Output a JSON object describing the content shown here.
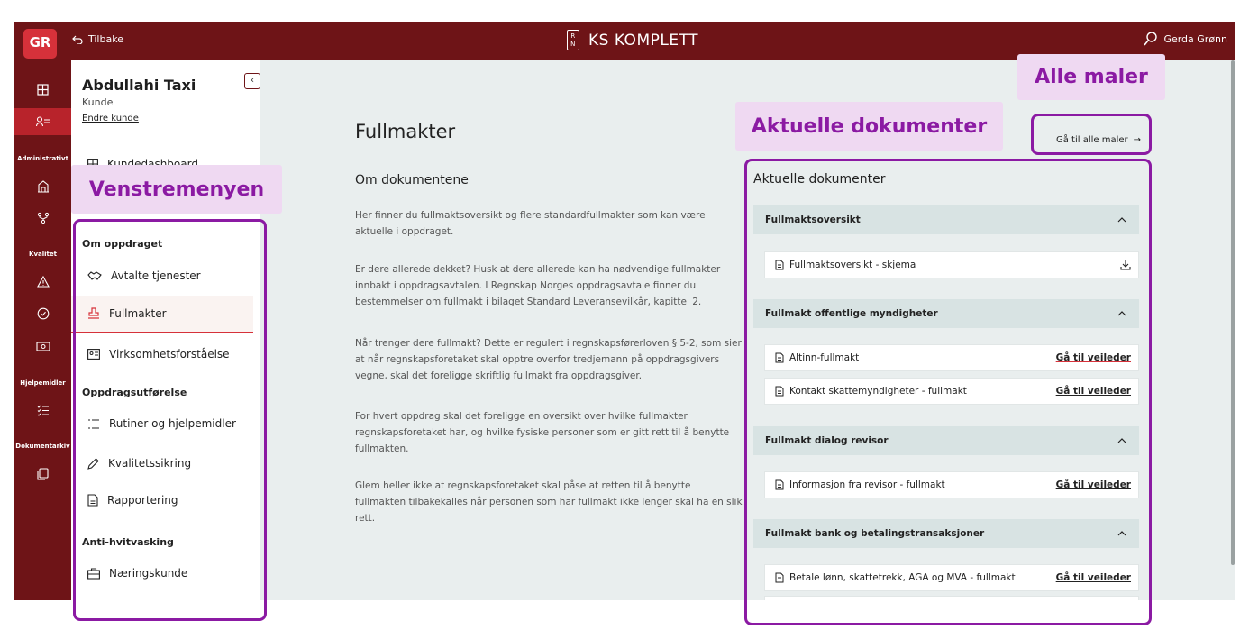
{
  "topbar": {
    "badge": "GR",
    "back_label": "Tilbake",
    "logo_letters": "R N",
    "app_title": "KS KOMPLETT",
    "user_name": "Gerda Grønn"
  },
  "rail": {
    "labels": [
      "Administrativt",
      "Kvalitet",
      "Hjelpemidler",
      "Dokumentarkiv"
    ],
    "icons": [
      "grid-icon",
      "people-list-icon",
      "building-icon",
      "network-icon",
      "warning-icon",
      "check-circle-icon",
      "money-icon",
      "checklist-icon",
      "documents-icon"
    ]
  },
  "client": {
    "name": "Abdullahi Taxi",
    "role": "Kunde",
    "change_link": "Endre kunde",
    "collapse_icon": "‹"
  },
  "nav": {
    "dashboard_label": "Kundedashboard",
    "section_om": "Om oppdraget",
    "avtalte": "Avtalte tjenester",
    "fullmakter": "Fullmakter",
    "virksomhet": "Virksomhetsforståelse",
    "section_utforelse": "Oppdragsutførelse",
    "rutiner": "Rutiner og hjelpemidler",
    "kvalitet": "Kvalitetssikring",
    "rapportering": "Rapportering",
    "section_anti": "Anti-hvitvasking",
    "naeringskunde": "Næringskunde"
  },
  "main": {
    "title": "Fullmakter",
    "heading": "Om dokumentene",
    "p1": "Her finner du fullmaktsoversikt og flere standardfullmakter som kan være aktuelle i oppdraget.",
    "p2": "Er dere allerede dekket? Husk at dere allerede kan ha nødvendige fullmakter innbakt i oppdragsavtalen. I Regnskap Norges oppdragsavtale finner du bestemmelser om fullmakt i bilaget Standard Leveransevilkår, kapittel 2.",
    "p3": "Når trenger dere fullmakt? Dette er regulert i regnskapsførerloven § 5-2, som sier at når regnskapsforetaket skal opptre overfor tredjemann på oppdragsgivers vegne, skal det foreligge skriftlig fullmakt fra oppdragsgiver.",
    "p4": "For hvert oppdrag skal det foreligge en oversikt over hvilke fullmakter regnskapsforetaket har, og hvilke fysiske personer som er gitt rett til å benytte fullmakten.",
    "p5": "Glem heller ikke at regnskapsforetaket skal påse at retten til å benytte fullmakten tilbakekalles når personen som har fullmakt ikke lenger skal ha en slik rett."
  },
  "docs": {
    "go_all": "Gå til alle maler",
    "title": "Aktuelle dokumenter",
    "g1_title": "Fullmaktsoversikt",
    "g1_item1": "Fullmaktsoversikt - skjema",
    "g2_title": "Fullmakt offentlige myndigheter",
    "g2_item1": "Altinn-fullmakt",
    "g2_item2": "Kontakt skattemyndigheter - fullmakt",
    "g3_title": "Fullmakt dialog revisor",
    "g3_item1": "Informasjon fra revisor - fullmakt",
    "g4_title": "Fullmakt bank og betalingstransaksjoner",
    "g4_item1": "Betale lønn, skattetrekk, AGA og MVA - fullmakt",
    "guide_link": "Gå til veileder"
  },
  "annotations": {
    "alle_maler": "Alle maler",
    "aktuelle": "Aktuelle dokumenter",
    "venstremenyen": "Venstremenyen",
    "color": "#8b1aa3",
    "label_bg": "#efd9f2"
  },
  "colors": {
    "brand_dark": "#6e1417",
    "brand_red": "#d6313a",
    "content_bg": "#e9eeee",
    "group_bg": "#d8e3e3"
  }
}
